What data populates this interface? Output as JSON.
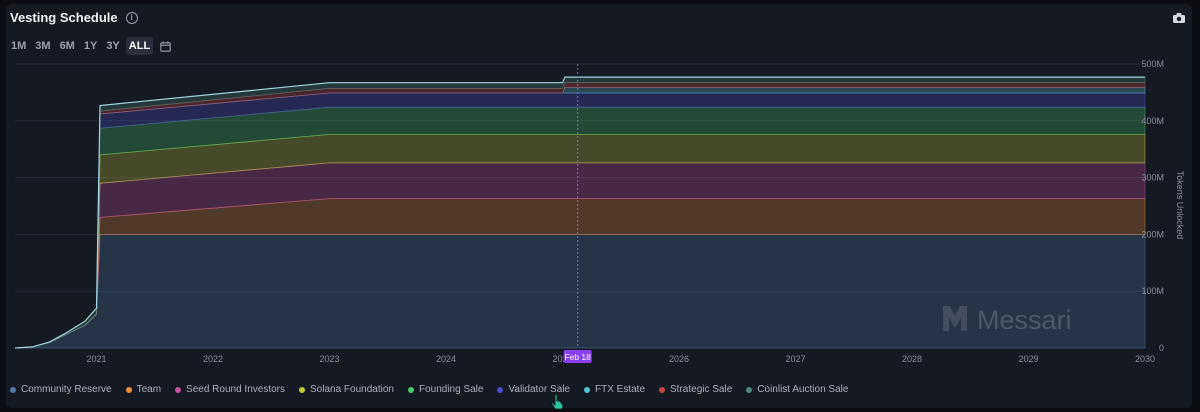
{
  "header": {
    "title": "Vesting Schedule"
  },
  "ranges": [
    "1M",
    "3M",
    "6M",
    "1Y",
    "3Y",
    "ALL"
  ],
  "active_range": "ALL",
  "icons": [
    "info-icon",
    "camera-icon",
    "calendar-icon"
  ],
  "watermark": "Messari",
  "colors": {
    "community_reserve": "#4e79a7",
    "team": "#e98b3b",
    "seed_round": "#c94fa3",
    "solana_foundation": "#c4c93a",
    "founding_sale": "#49c96b",
    "validator_sale": "#4a4ed1",
    "ftx_estate": "#55bfd4",
    "strategic_sale": "#c94444",
    "coinlist": "#4c8a7a"
  },
  "chart_data": {
    "type": "area",
    "stacked": true,
    "xlabel": "",
    "ylabel": "Tokens Unlocked",
    "ylim": [
      0,
      500
    ],
    "y_unit": "M",
    "xlim": [
      2020.3,
      2030.0
    ],
    "x_ticks": [
      "2021",
      "2022",
      "2023",
      "2024",
      "2025",
      "2026",
      "2027",
      "2028",
      "2029",
      "2030"
    ],
    "y_ticks": [
      "0",
      "100M",
      "200M",
      "300M",
      "400M",
      "500M"
    ],
    "grid": true,
    "legend_position": "bottom",
    "marker": {
      "label": "Feb 18",
      "x": 2025.13
    },
    "x": [
      2020.3,
      2020.45,
      2020.6,
      2020.75,
      2020.9,
      2021.0,
      2021.03,
      2023.0,
      2025.0,
      2025.02,
      2030.0
    ],
    "series": [
      {
        "name": "Community Reserve",
        "color": "#4e79a7",
        "values": [
          0,
          2,
          10,
          25,
          40,
          60,
          200,
          200,
          200,
          200,
          200
        ]
      },
      {
        "name": "Team",
        "color": "#e98b3b",
        "values": [
          0,
          0,
          0,
          0,
          0,
          0,
          30,
          63,
          63,
          63,
          63
        ]
      },
      {
        "name": "Seed Round Investors",
        "color": "#c94fa3",
        "values": [
          0,
          0,
          0,
          0,
          0,
          0,
          60,
          63,
          63,
          63,
          63
        ]
      },
      {
        "name": "Solana Foundation",
        "color": "#c4c93a",
        "values": [
          0,
          0,
          0,
          0,
          0,
          0,
          50,
          50,
          50,
          50,
          50
        ]
      },
      {
        "name": "Founding Sale",
        "color": "#49c96b",
        "values": [
          0,
          0,
          0,
          0,
          0,
          0,
          47,
          48,
          48,
          48,
          48
        ]
      },
      {
        "name": "Validator Sale",
        "color": "#4a4ed1",
        "values": [
          0,
          0,
          0,
          0,
          0,
          0,
          25,
          25,
          25,
          25,
          25
        ]
      },
      {
        "name": "FTX Estate",
        "color": "#55bfd4",
        "values": [
          0,
          0,
          0,
          0,
          0,
          0,
          0,
          0,
          0,
          10,
          10
        ]
      },
      {
        "name": "Strategic Sale",
        "color": "#c94444",
        "values": [
          0,
          0,
          0,
          0,
          0,
          0,
          5,
          8,
          8,
          8,
          8
        ]
      },
      {
        "name": "Coinlist Auction Sale",
        "color": "#4c8a7a",
        "values": [
          0,
          0,
          1,
          3,
          7,
          10,
          10,
          10,
          10,
          10,
          10
        ]
      }
    ]
  }
}
